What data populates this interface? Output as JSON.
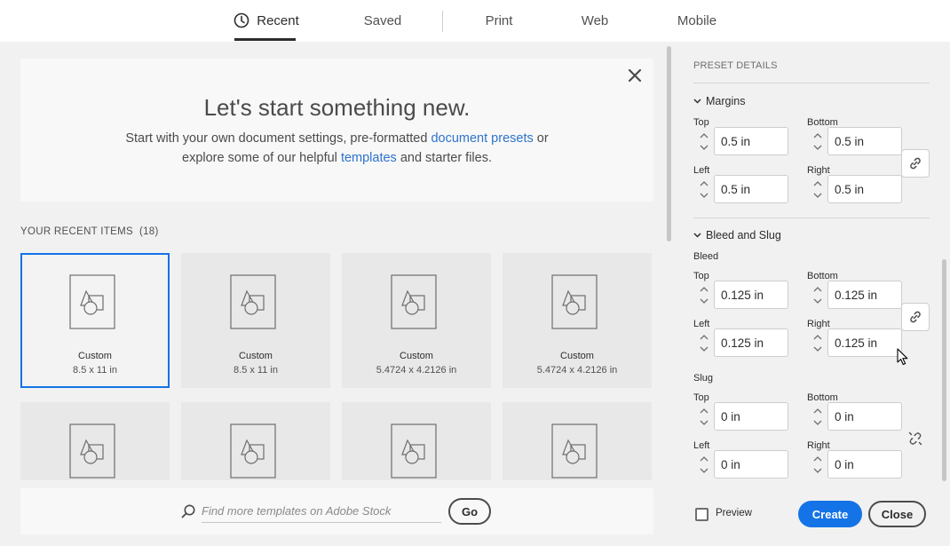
{
  "tabs": [
    {
      "label": "Recent",
      "icon": "clock-icon",
      "active": true
    },
    {
      "label": "Saved"
    },
    {
      "label": "Print"
    },
    {
      "label": "Web"
    },
    {
      "label": "Mobile"
    }
  ],
  "hero": {
    "title": "Let's start something new.",
    "line1_prefix": "Start with your own document settings, pre-formatted ",
    "line1_link": "document presets",
    "line1_suffix": " or",
    "line2_prefix": "explore some of our helpful ",
    "line2_link": "templates",
    "line2_suffix": " and starter files."
  },
  "recent": {
    "label": "YOUR RECENT ITEMS",
    "count": "(18)",
    "items": [
      {
        "name": "Custom",
        "size": "8.5 x 11 in",
        "selected": true
      },
      {
        "name": "Custom",
        "size": "8.5 x 11 in"
      },
      {
        "name": "Custom",
        "size": "5.4724 x 4.2126 in"
      },
      {
        "name": "Custom",
        "size": "5.4724 x 4.2126 in"
      },
      {
        "name": "",
        "size": ""
      },
      {
        "name": "",
        "size": ""
      },
      {
        "name": "",
        "size": ""
      },
      {
        "name": "",
        "size": ""
      }
    ]
  },
  "search": {
    "placeholder": "Find more templates on Adobe Stock",
    "go_label": "Go"
  },
  "panel": {
    "title": "PRESET DETAILS",
    "margins": {
      "title": "Margins",
      "top_label": "Top",
      "top": "0.5 in",
      "bottom_label": "Bottom",
      "bottom": "0.5 in",
      "left_label": "Left",
      "left": "0.5 in",
      "right_label": "Right",
      "right": "0.5 in"
    },
    "bleed_slug": {
      "title": "Bleed and Slug",
      "bleed_label": "Bleed",
      "bleed": {
        "top_label": "Top",
        "top": "0.125 in",
        "bottom_label": "Bottom",
        "bottom": "0.125 in",
        "left_label": "Left",
        "left": "0.125 in",
        "right_label": "Right",
        "right": "0.125 in"
      },
      "slug_label": "Slug",
      "slug": {
        "top_label": "Top",
        "top": "0 in",
        "bottom_label": "Bottom",
        "bottom": "0 in",
        "left_label": "Left",
        "left": "0 in",
        "right_label": "Right",
        "right": "0 in"
      }
    },
    "preview_label": "Preview",
    "create_label": "Create",
    "close_label": "Close"
  },
  "colors": {
    "accent": "#1473e6",
    "link": "#2d73cc"
  }
}
